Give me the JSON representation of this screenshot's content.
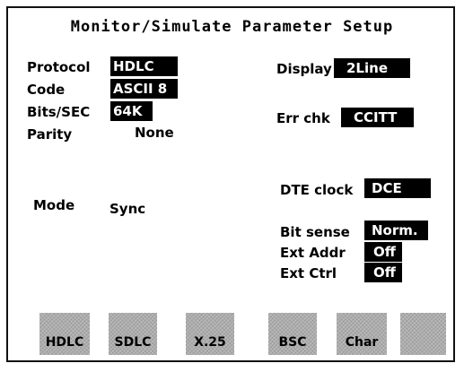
{
  "title": "Monitor/Simulate Parameter Setup",
  "left": {
    "protocol": {
      "label": "Protocol",
      "value": "HDLC"
    },
    "code": {
      "label": "Code",
      "value": "ASCII 8"
    },
    "bits": {
      "label": "Bits/SEC",
      "value": "64K"
    },
    "parity": {
      "label": "Parity",
      "value": "None"
    },
    "mode": {
      "label": "Mode",
      "value": "Sync"
    }
  },
  "right": {
    "display": {
      "label": "Display",
      "value": "2Line"
    },
    "errchk": {
      "label": "Err chk",
      "value": "CCITT"
    },
    "dteclock": {
      "label": "DTE clock",
      "value": "DCE"
    },
    "bitsense": {
      "label": "Bit sense",
      "value": "Norm."
    },
    "extaddr": {
      "label": "Ext Addr",
      "value": "Off"
    },
    "extctrl": {
      "label": "Ext Ctrl",
      "value": "Off"
    }
  },
  "softkeys": [
    "HDLC",
    "SDLC",
    "X.25",
    "BSC",
    "Char",
    ""
  ]
}
